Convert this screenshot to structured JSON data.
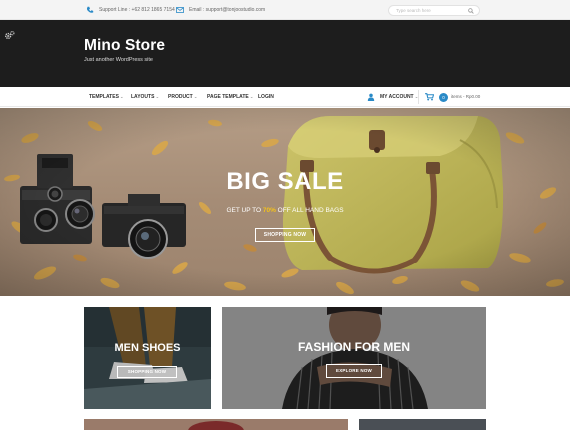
{
  "topbar": {
    "support": "Support Line : +62 812 1865 7154",
    "email": "Email : support@tonjoostudio.com",
    "search_placeholder": "Type search here"
  },
  "header": {
    "title": "Mino Store",
    "tagline": "Just another WordPress site"
  },
  "nav": {
    "items": [
      "TEMPLATES",
      "LAYOUTS",
      "PRODUCT",
      "PAGE TEMPLATE",
      "LOGIN"
    ],
    "account": "MY ACCOUNT",
    "cart_count": "0",
    "cart_text": "items - Rp0.00"
  },
  "hero": {
    "title": "BIG SALE",
    "sub_prefix": "GET UP TO ",
    "sub_highlight": "70%",
    "sub_suffix": " OFF ALL HAND BAGS",
    "button": "SHOPPING NOW"
  },
  "cards": {
    "men_shoes": {
      "title": "MEN SHOES",
      "button": "SHOPPING NOW"
    },
    "fashion_men": {
      "title": "FASHION FOR MEN",
      "button": "EXPLORE NOW"
    }
  },
  "colors": {
    "header_bg": "#1d1d1d",
    "accent": "#2a8ac7"
  }
}
